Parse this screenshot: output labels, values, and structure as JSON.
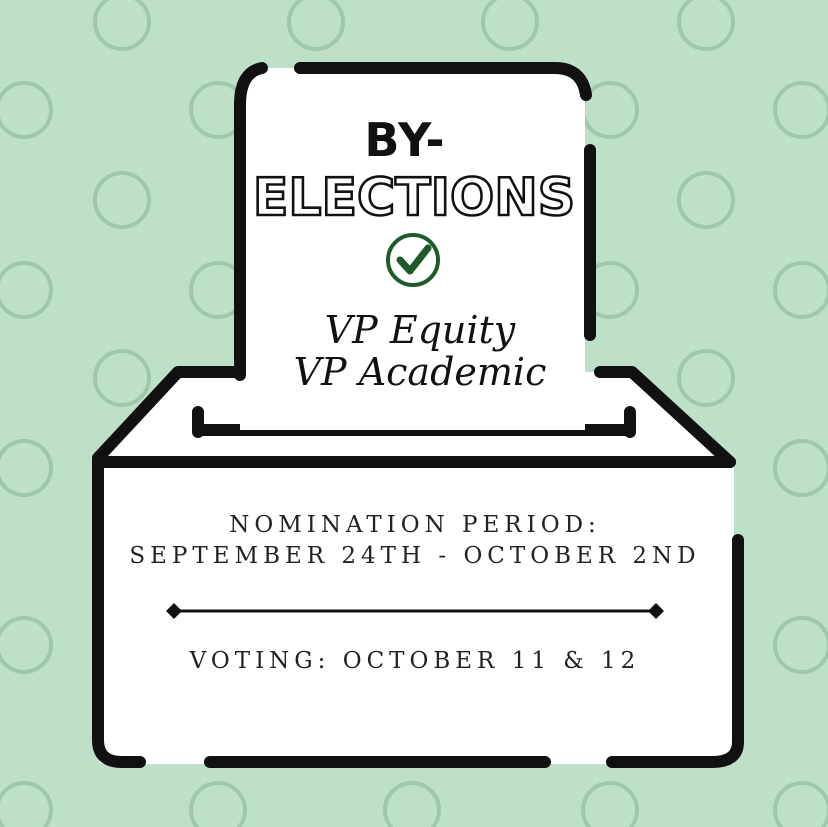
{
  "colors": {
    "background": "#bfe0c8",
    "circle_outline": "#9fc7ab",
    "ink": "#111111",
    "check": "#1f5a2a"
  },
  "ballot": {
    "title_line1": "BY-",
    "title_line2": "ELECTIONS",
    "check_icon": "check-circle-icon",
    "positions": [
      "VP Equity",
      "VP Academic"
    ]
  },
  "box": {
    "nomination_label": "NOMINATION PERIOD:",
    "nomination_dates": "SEPTEMBER 24TH - OCTOBER 2ND",
    "voting": "VOTING: OCTOBER 11 & 12"
  }
}
